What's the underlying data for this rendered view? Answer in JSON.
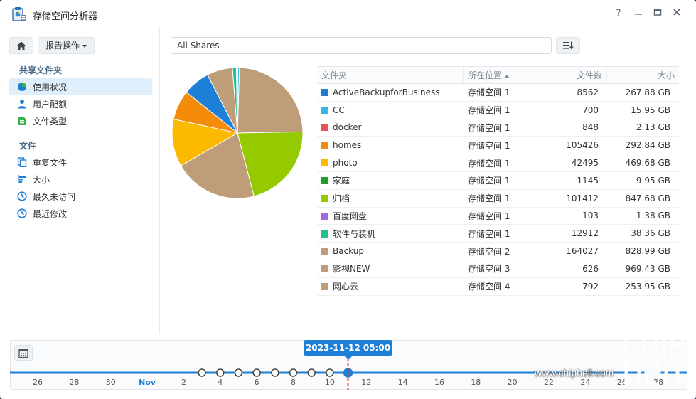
{
  "app": {
    "title": "存储空间分析器"
  },
  "window_controls": {
    "help": "?",
    "minimize": "—",
    "maximize": "▣",
    "close": "✕"
  },
  "sidebar": {
    "report_button": "报告操作",
    "sections": [
      {
        "title": "共享文件夹",
        "items": [
          {
            "label": "使用状况",
            "icon": "pie-icon",
            "active": true
          },
          {
            "label": "用户配额",
            "icon": "user-icon",
            "active": false
          },
          {
            "label": "文件类型",
            "icon": "file-type-icon",
            "active": false
          }
        ]
      },
      {
        "title": "文件",
        "items": [
          {
            "label": "重复文件",
            "icon": "duplicate-icon",
            "active": false
          },
          {
            "label": "大小",
            "icon": "size-icon",
            "active": false
          },
          {
            "label": "最久未访问",
            "icon": "clock-icon",
            "active": false
          },
          {
            "label": "最近修改",
            "icon": "clock-icon",
            "active": false
          }
        ]
      }
    ]
  },
  "filter": {
    "value": "All Shares"
  },
  "table": {
    "headers": [
      "文件夹",
      "所在位置",
      "文件数",
      "大小"
    ],
    "rows": [
      {
        "folder": "ActiveBackupforBusiness",
        "location": "存储空间 1",
        "count": "8562",
        "size": "267.88 GB",
        "color": "#1e7fd6"
      },
      {
        "folder": "CC",
        "location": "存储空间 1",
        "count": "700",
        "size": "15.95 GB",
        "color": "#35b6ec"
      },
      {
        "folder": "docker",
        "location": "存储空间 1",
        "count": "848",
        "size": "2.13 GB",
        "color": "#ef4f56"
      },
      {
        "folder": "homes",
        "location": "存储空间 1",
        "count": "105426",
        "size": "292.84 GB",
        "color": "#f58b0a"
      },
      {
        "folder": "photo",
        "location": "存储空间 1",
        "count": "42495",
        "size": "469.68 GB",
        "color": "#fbb900"
      },
      {
        "folder": "家庭",
        "location": "存储空间 1",
        "count": "1145",
        "size": "9.95 GB",
        "color": "#1ea02a"
      },
      {
        "folder": "归档",
        "location": "存储空间 1",
        "count": "101412",
        "size": "847.68 GB",
        "color": "#95c900"
      },
      {
        "folder": "百度网盘",
        "location": "存储空间 1",
        "count": "103",
        "size": "1.38 GB",
        "color": "#a367dc"
      },
      {
        "folder": "软件与装机",
        "location": "存储空间 1",
        "count": "12912",
        "size": "38.36 GB",
        "color": "#24bf91"
      },
      {
        "folder": "Backup",
        "location": "存储空间 2",
        "count": "164027",
        "size": "828.99 GB",
        "color": "#bf9d78"
      },
      {
        "folder": "影视NEW",
        "location": "存储空间 3",
        "count": "626",
        "size": "969.43 GB",
        "color": "#bf9d78"
      },
      {
        "folder": "网心云",
        "location": "存储空间 4",
        "count": "792",
        "size": "253.95 GB",
        "color": "#bf9d78"
      }
    ]
  },
  "timeline": {
    "selected": "2023-11-12 05:00",
    "labels": [
      "26",
      "28",
      "30",
      "Nov",
      "2",
      "4",
      "6",
      "8",
      "10",
      "12",
      "14",
      "16",
      "18",
      "20",
      "22",
      "24",
      "26",
      "28"
    ],
    "snapshot_days": [
      "4",
      "5",
      "6",
      "7",
      "8",
      "9",
      "10",
      "11",
      "12"
    ],
    "accent": "#1e7fd6",
    "marker_color": "#e03a3a"
  },
  "watermark": {
    "text": "www.chiphell.com"
  }
}
